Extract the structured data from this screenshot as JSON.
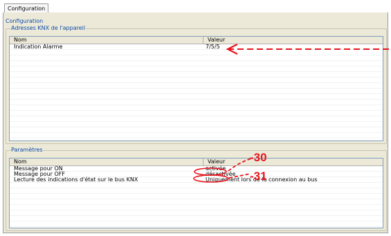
{
  "tab": {
    "label": "Configuration"
  },
  "panel": {
    "title": "Configuration"
  },
  "group1": {
    "label": "Adresses KNX de l'appareil",
    "columns": [
      "Nom",
      "Valeur"
    ],
    "rows": [
      {
        "name": "Indication Alarme",
        "value": "7/5/5"
      }
    ]
  },
  "group2": {
    "label": "Paramètres",
    "columns": [
      "Nom",
      "Valeur"
    ],
    "rows": [
      {
        "name": "Message pour ON",
        "value": "activée"
      },
      {
        "name": "Message pour OFF",
        "value": "désactivée"
      },
      {
        "name": "Lecture des indications d'état sur le bus KNX",
        "value": "Uniquement lors de la connexion au bus"
      }
    ]
  },
  "annotations": {
    "callout_on": "-30",
    "callout_off": "-31",
    "color": "#e8141c"
  },
  "colors": {
    "group_label": "#0a4aa8",
    "panel_bg": "#ece9d8"
  }
}
